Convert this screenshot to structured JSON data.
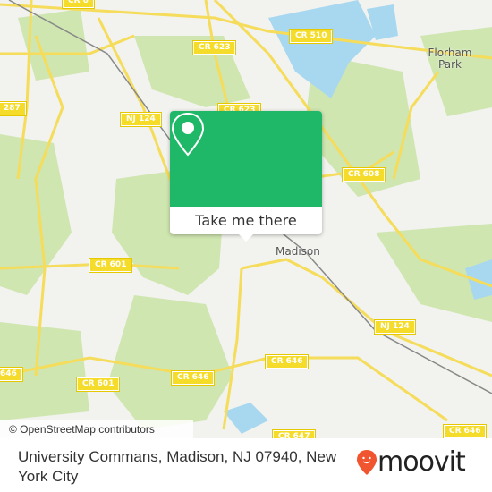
{
  "map": {
    "shields": [
      {
        "label": "CR 6",
        "id": "cr-top"
      },
      {
        "label": "CR 623",
        "id": "cr623-a"
      },
      {
        "label": "CR 510",
        "id": "cr510"
      },
      {
        "label": "287",
        "id": "i287"
      },
      {
        "label": "NJ 124",
        "id": "nj124-a"
      },
      {
        "label": "CR 623",
        "id": "cr623-b"
      },
      {
        "label": "CR 608",
        "id": "cr608"
      },
      {
        "label": "CR 601",
        "id": "cr601-a"
      },
      {
        "label": "NJ 124",
        "id": "nj124-b"
      },
      {
        "label": "CR 646",
        "id": "cr646-a"
      },
      {
        "label": "646",
        "id": "cr646-b"
      },
      {
        "label": "CR 601",
        "id": "cr601-b"
      },
      {
        "label": "CR 646",
        "id": "cr646-c"
      },
      {
        "label": "CR 647",
        "id": "cr647"
      },
      {
        "label": "CR 646",
        "id": "cr646-d"
      }
    ],
    "places": [
      {
        "label": "Florham Park",
        "id": "florham-park"
      },
      {
        "label": "Madison",
        "id": "madison"
      }
    ],
    "attribution": "© OpenStreetMap contributors",
    "colors": {
      "land": "#f2f2ee",
      "park": "#cfe6b0",
      "water": "#a8d8f0",
      "road": "#f5dc5a"
    }
  },
  "popup": {
    "icon": "map-pin-icon",
    "button_label": "Take me there",
    "color": "#1fb868"
  },
  "footer": {
    "address": "University Commans, Madison, NJ 07940, New York City",
    "logo_text": "moovit",
    "logo_color": "#f0552f"
  }
}
